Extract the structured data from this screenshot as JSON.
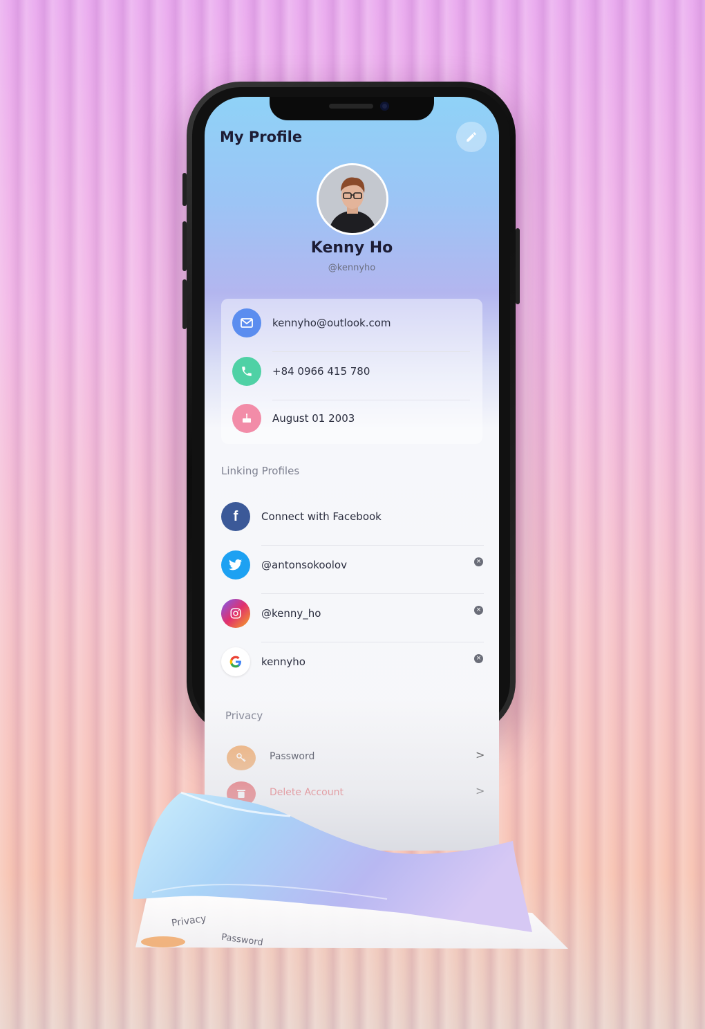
{
  "screen": {
    "title": "My Profile",
    "edit_icon": "pencil-icon"
  },
  "profile": {
    "name": "Kenny Ho",
    "handle": "@kennyho"
  },
  "contact": {
    "email": "kennyho@outlook.com",
    "phone": "+84 0966 415 780",
    "birthday": "August 01 2003"
  },
  "linking": {
    "section_label": "Linking Profiles",
    "facebook": "Connect with Facebook",
    "twitter": "@antonsokoolov",
    "instagram": "@kenny_ho",
    "google": "kennyho"
  },
  "privacy": {
    "section_label": "Privacy",
    "password": "Password",
    "delete": "Delete Account",
    "chevron": ">"
  },
  "paper": {
    "privacy": "Privacy",
    "password": "Password"
  },
  "colors": {
    "email_icon": "#5b8def",
    "phone_icon": "#4fd1a5",
    "birthday_icon": "#f28ca8",
    "facebook": "#3b5998",
    "twitter": "#1da1f2",
    "password_icon": "#f0a868",
    "delete_icon": "#e5484d",
    "delete_text": "#e5484d"
  }
}
